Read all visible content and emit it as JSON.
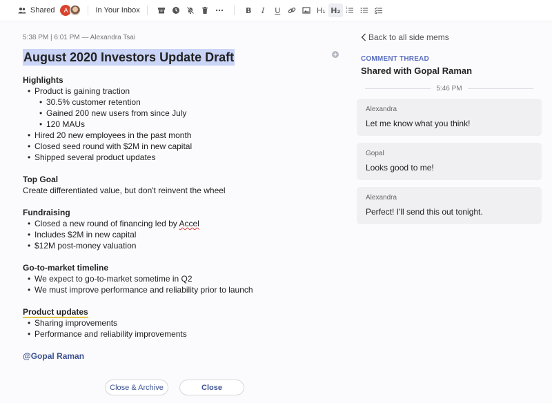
{
  "toolbar": {
    "shared_label": "Shared",
    "avatar_initial": "A",
    "inbox_label": "In Your Inbox",
    "icons": [
      "archive-icon",
      "clock-icon",
      "bell-off-icon",
      "trash-icon",
      "more-icon"
    ],
    "format_icons": [
      "bold-icon",
      "italic-icon",
      "underline-icon",
      "link-icon",
      "image-icon",
      "heading1-icon",
      "heading2-icon",
      "ordered-list-icon",
      "bullet-list-icon",
      "checklist-icon"
    ],
    "format_glyphs": {
      "bold": "B",
      "italic": "I",
      "underline": "U",
      "h1": "H₁",
      "h2": "H₂"
    }
  },
  "document": {
    "meta": "5:38 PM | 6:01 PM — Alexandra Tsai",
    "title": "August 2020 Investors Update Draft",
    "highlights": {
      "heading": "Highlights",
      "item1": "Product is gaining traction",
      "sub1": "30.5% customer retention",
      "sub2": "Gained 200 new users from since July",
      "sub3": "120 MAUs",
      "item2": "Hired 20 new employees in the past month",
      "item3": "Closed seed round with $2M in new capital",
      "item4": "Shipped several product updates"
    },
    "top_goal": {
      "heading": "Top Goal",
      "text": "Create differentiated value, but don't reinvent the wheel"
    },
    "fundraising": {
      "heading": "Fundraising",
      "item1_prefix": "Closed a new round of financing led by ",
      "item1_name": "Accel",
      "item2": "Includes $2M in new capital",
      "item3": "$12M post-money valuation"
    },
    "gtm": {
      "heading": "Go-to-market timeline",
      "item1": "We expect to go-to-market sometime in Q2",
      "item2": "We must improve performance and reliability prior to launch"
    },
    "product": {
      "heading": "Product updates",
      "item1": "Sharing improvements",
      "item2": "Performance and reliability improvements"
    },
    "mention": "@Gopal Raman"
  },
  "actions": {
    "archive_label": "Close & Archive",
    "close_label": "Close"
  },
  "panel": {
    "back_label": "Back to all side mems",
    "thread_label": "COMMENT THREAD",
    "thread_title": "Shared with Gopal Raman",
    "time": "5:46 PM",
    "comments": [
      {
        "author": "Alexandra",
        "message": "Let me know what you think!"
      },
      {
        "author": "Gopal",
        "message": "Looks good to me!"
      },
      {
        "author": "Alexandra",
        "message": "Perfect! I'll send this out tonight."
      }
    ]
  },
  "colors": {
    "accent": "#3d5291",
    "title_highlight": "#c9d4f7",
    "thread_label": "#5a6fc0",
    "bubble": "#f0f0f2"
  }
}
